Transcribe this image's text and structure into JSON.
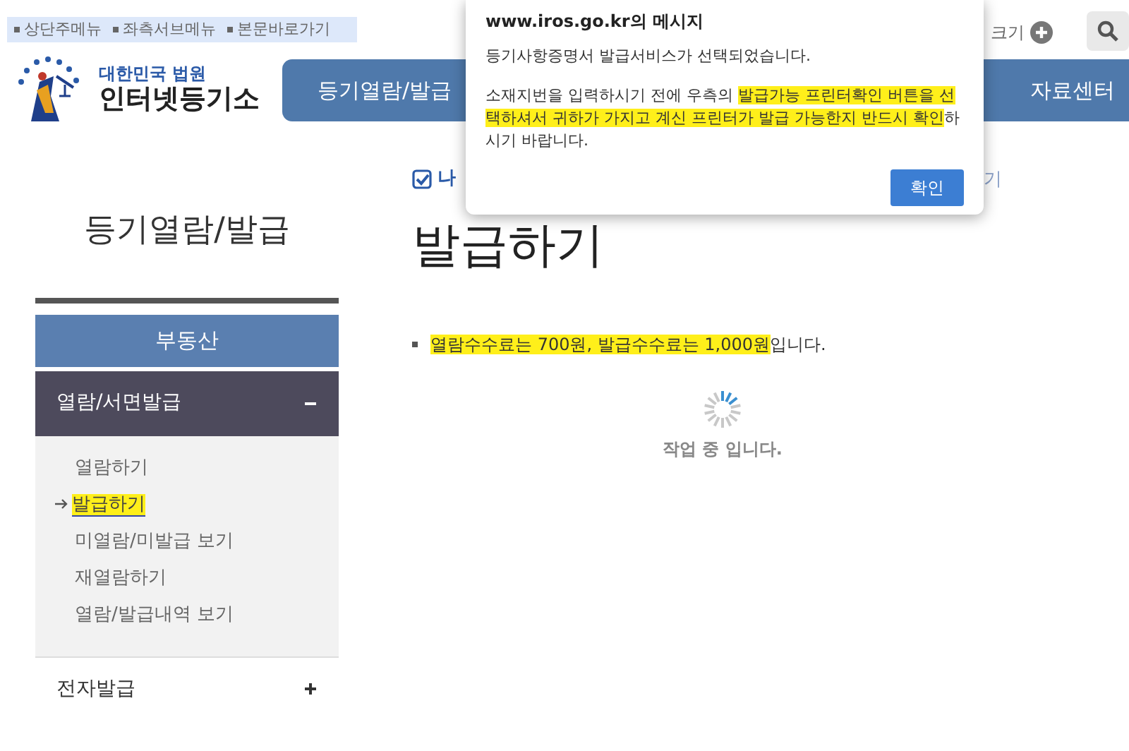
{
  "skip_links": [
    "상단주메뉴",
    "좌측서브메뉴",
    "본문바로가기"
  ],
  "tools": {
    "font_size_label": "크기"
  },
  "logo": {
    "subtitle": "대한민국 법원",
    "title": "인터넷등기소"
  },
  "main_nav": [
    {
      "label": "등기열람/발급"
    },
    {
      "label": "자료센터"
    }
  ],
  "breadcrumb": {
    "label": "나",
    "tail": "기"
  },
  "sidebar": {
    "title": "등기열람/발급",
    "sections": [
      {
        "kind": "header",
        "label": "부동산"
      },
      {
        "kind": "group",
        "label": "열람/서면발급",
        "expanded": true,
        "children": [
          {
            "label": "열람하기",
            "selected": false
          },
          {
            "label": "발급하기",
            "selected": true
          },
          {
            "label": "미열람/미발급 보기",
            "selected": false
          },
          {
            "label": "재열람하기",
            "selected": false
          },
          {
            "label": "열람/발급내역 보기",
            "selected": false
          }
        ]
      },
      {
        "kind": "group",
        "label": "전자발급",
        "expanded": false
      }
    ]
  },
  "content": {
    "heading": "발급하기",
    "fee_notice": [
      {
        "text": "열람수수료는 700원, 발급수수료는 1,000원",
        "highlight": true
      },
      {
        "text": "입니다.",
        "highlight": false
      }
    ],
    "loading_text": "작업 중 입니다."
  },
  "dialog": {
    "title": "www.iros.go.kr의 메시지",
    "paragraphs": [
      [
        {
          "text": "등기사항증명서 발급서비스가 선택되었습니다.",
          "highlight": false
        }
      ],
      [
        {
          "text": "소재지번을 입력하시기 전에 우측의 ",
          "highlight": false
        },
        {
          "text": "발급가능 프린터확인 버튼을 선택하셔서 귀하가 가지고 계신 프린터가 발급 가능한지 반드시 확인",
          "highlight": true
        },
        {
          "text": "하시기 바랍니다.",
          "highlight": false
        }
      ]
    ],
    "button": "확인"
  }
}
